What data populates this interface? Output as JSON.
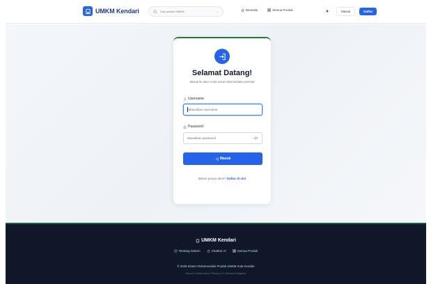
{
  "header": {
    "brand": "UMKM Kendari",
    "search_placeholder": "Cari produk UMKM...",
    "nav": [
      {
        "label": "Beranda",
        "icon": "home-icon"
      },
      {
        "label": "Semua Produk",
        "icon": "grid-icon"
      }
    ],
    "login_label": "Masuk",
    "register_label": "Daftar"
  },
  "login_card": {
    "title": "Selamat Datang!",
    "subtitle": "Masuk ke akun Anda untuk rekomendasi personal",
    "username_label": "Username",
    "username_placeholder": "Masukkan username",
    "password_label": "Password",
    "password_placeholder": "Masukkan password",
    "submit_label": "Masuk",
    "no_account_text": "Belum punya akun?",
    "register_link": "Daftar di sini"
  },
  "footer": {
    "brand": "UMKM Kendari",
    "links": [
      {
        "label": "Tentang Sistem",
        "icon": "info-icon"
      },
      {
        "label": "Chatbot AI",
        "icon": "robot-icon"
      },
      {
        "label": "Semua Produk",
        "icon": "grid-icon"
      }
    ],
    "copyright": "© 2026 Sistem Rekomendasi Produk UMKM Kota Kendari",
    "method": "Neural Collaborative Filtering & K-Nearest Neighbor"
  },
  "colors": {
    "primary": "#2563eb",
    "brand_text": "#1e3a8a",
    "footer_bg": "#0f1729",
    "accent_green": "#15803d"
  }
}
